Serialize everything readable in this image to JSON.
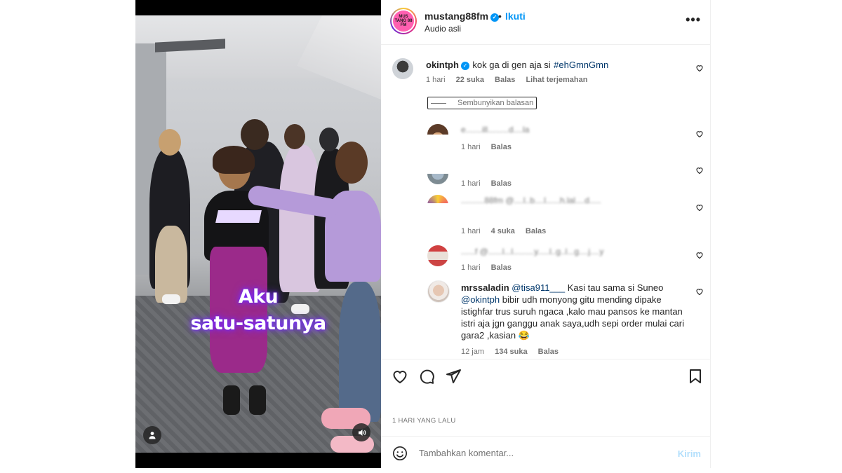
{
  "post": {
    "username": "mustang88fm",
    "follow_label": "Ikuti",
    "separator": "•",
    "audio_label": "Audio asli",
    "more_label": "•••",
    "avatar_text": "MUS TANG 88 FM",
    "caption_line1": "Aku",
    "caption_line2": "satu-satunya",
    "time_ago": "1 HARI YANG LALU"
  },
  "comments": {
    "main": {
      "username": "okintph",
      "text": "kok ga di gen aja si",
      "hashtag": "#ehGmnGmn",
      "time": "1 hari",
      "likes": "22 suka",
      "reply": "Balas",
      "translate": "Lihat terjemahan"
    },
    "hide_replies": "Sembunyikan balasan",
    "replies": [
      {
        "blurred_text": "e.......ill.........d....la",
        "time": "1 hari",
        "reply": "Balas",
        "likes": ""
      },
      {
        "blurred_text": "",
        "time": "1 hari",
        "reply": "Balas",
        "likes": ""
      },
      {
        "blurred_text": "..........88fm @....l..b....l......h.lal....d.....",
        "time": "1 hari",
        "likes": "4 suka",
        "reply": "Balas"
      },
      {
        "blurred_text": "......f @......l...l.........y.....l..g..l...g....j....y",
        "time": "1 hari",
        "reply": "Balas",
        "likes": ""
      }
    ],
    "last": {
      "username": "mrssaladin",
      "mention1": "@tisa911___",
      "text1": " Kasi tau sama si Suneo",
      "mention2": "@okintph",
      "text2": " bibir udh monyong gitu mending dipake istighfar trus suruh ngaca ,kalo mau pansos ke mantan istri aja jgn ganggu anak saya,udh sepi order mulai cari gara2 ,kasian 😂",
      "time": "12 jam",
      "likes": "134 suka",
      "reply": "Balas"
    }
  },
  "composer": {
    "placeholder": "Tambahkan komentar...",
    "post_label": "Kirim"
  },
  "icons": {
    "verified": "verified-badge-icon",
    "heart": "heart-icon",
    "comment": "comment-icon",
    "share": "share-icon",
    "save": "bookmark-icon",
    "emoji": "emoji-icon",
    "audio": "speaker-icon",
    "tagged": "user-tag-icon"
  },
  "colors": {
    "link_blue": "#0095f6",
    "mention_blue": "#00376b",
    "muted": "#737373",
    "post_disabled": "#b2dffc",
    "caption_glow": "#7a2cff"
  }
}
